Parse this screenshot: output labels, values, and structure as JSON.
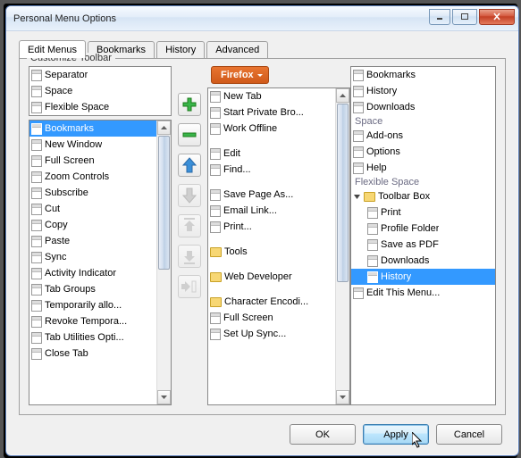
{
  "window": {
    "title": "Personal Menu Options"
  },
  "tabs": [
    {
      "label": "Edit Menus",
      "active": true
    },
    {
      "label": "Bookmarks",
      "active": false
    },
    {
      "label": "History",
      "active": false
    },
    {
      "label": "Advanced",
      "active": false
    }
  ],
  "groupLabel": "Customize Toolbar",
  "leftTop": [
    {
      "label": "Separator"
    },
    {
      "label": "Space"
    },
    {
      "label": "Flexible Space"
    }
  ],
  "leftList": [
    {
      "label": "Bookmarks",
      "selected": true
    },
    {
      "label": "New Window"
    },
    {
      "label": "Full Screen"
    },
    {
      "label": "Zoom Controls"
    },
    {
      "label": "Subscribe"
    },
    {
      "label": "Cut"
    },
    {
      "label": "Copy"
    },
    {
      "label": "Paste"
    },
    {
      "label": "Sync"
    },
    {
      "label": "Activity Indicator"
    },
    {
      "label": "Tab Groups"
    },
    {
      "label": "Temporarily allo..."
    },
    {
      "label": "Revoke Tempora..."
    },
    {
      "label": "Tab Utilities Opti..."
    },
    {
      "label": "Close Tab"
    }
  ],
  "firefoxLabel": "Firefox",
  "midList": [
    {
      "label": "New Tab",
      "icon": "page"
    },
    {
      "label": "Start Private Bro...",
      "icon": "page"
    },
    {
      "label": "Work Offline",
      "icon": "page"
    },
    {
      "gap": true
    },
    {
      "label": "Edit",
      "icon": "page"
    },
    {
      "label": "Find...",
      "icon": "page"
    },
    {
      "gap": true
    },
    {
      "label": "Save Page As...",
      "icon": "page"
    },
    {
      "label": "Email Link...",
      "icon": "page"
    },
    {
      "label": "Print...",
      "icon": "page"
    },
    {
      "gap": true
    },
    {
      "label": "Tools",
      "icon": "folder"
    },
    {
      "gap": true
    },
    {
      "label": "Web Developer",
      "icon": "folder"
    },
    {
      "gap": true
    },
    {
      "label": "Character Encodi...",
      "icon": "folder"
    },
    {
      "label": "Full Screen",
      "icon": "page"
    },
    {
      "label": "Set Up Sync...",
      "icon": "page"
    }
  ],
  "rightList": [
    {
      "label": "Bookmarks",
      "icon": "page"
    },
    {
      "label": "History",
      "icon": "page"
    },
    {
      "label": "Downloads",
      "icon": "page"
    },
    {
      "section": "Space"
    },
    {
      "label": "Add-ons",
      "icon": "page"
    },
    {
      "label": "Options",
      "icon": "page"
    },
    {
      "label": "Help",
      "icon": "page"
    },
    {
      "section": "Flexible Space"
    },
    {
      "label": "Toolbar Box",
      "icon": "folder",
      "expanded": true
    },
    {
      "label": "Print",
      "icon": "page",
      "child": true
    },
    {
      "label": "Profile Folder",
      "icon": "page",
      "child": true
    },
    {
      "label": "Save as PDF",
      "icon": "page",
      "child": true
    },
    {
      "label": "Downloads",
      "icon": "page",
      "child": true
    },
    {
      "label": "History",
      "icon": "page",
      "child": true,
      "selected": true
    },
    {
      "label": "Edit This Menu...",
      "icon": "page"
    }
  ],
  "controls": [
    {
      "name": "add",
      "color": "#39b54a",
      "disabled": false
    },
    {
      "name": "remove",
      "color": "#39b54a",
      "disabled": false
    },
    {
      "name": "move-up",
      "color": "#3a8fd8",
      "disabled": false
    },
    {
      "name": "move-down",
      "color": "#b0b0b0",
      "disabled": true
    },
    {
      "name": "move-top",
      "color": "#b0b0b0",
      "disabled": true
    },
    {
      "name": "move-bottom",
      "color": "#b0b0b0",
      "disabled": true
    },
    {
      "name": "move-out",
      "color": "#b0b0b0",
      "disabled": true
    }
  ],
  "buttons": {
    "ok": "OK",
    "apply": "Apply",
    "cancel": "Cancel"
  }
}
